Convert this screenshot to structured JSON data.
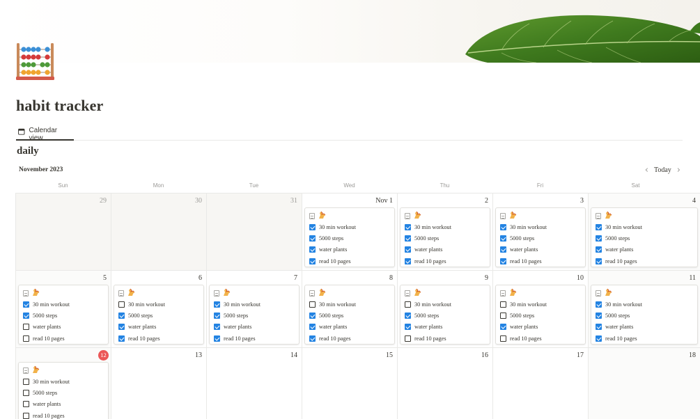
{
  "page": {
    "title": "habit tracker",
    "icon": "abacus-icon",
    "cover": "fig-leaf-cover"
  },
  "views": [
    {
      "label": "Calendar view",
      "icon": "calendar-icon",
      "active": true
    }
  ],
  "section_title": "daily",
  "calendar": {
    "month": "November 2023",
    "today_label": "Today",
    "prev_icon": "chevron-left-icon",
    "next_icon": "chevron-right-icon",
    "weekdays": [
      "Sun",
      "Mon",
      "Tue",
      "Wed",
      "Thu",
      "Fri",
      "Sat"
    ],
    "habit_labels": [
      "30 min workout",
      "5000 steps",
      "water plants",
      "read 10 pages"
    ],
    "card_icons": [
      "page-icon",
      "flexed-arm-emoji-icon"
    ],
    "colors": {
      "checkbox_checked": "#2383e2",
      "today_badge": "#eb5757"
    },
    "weeks": [
      [
        {
          "day": "29",
          "other": true
        },
        {
          "day": "30",
          "other": true
        },
        {
          "day": "31",
          "other": true
        },
        {
          "day": "Nov 1",
          "habits": [
            true,
            true,
            true,
            true
          ]
        },
        {
          "day": "2",
          "habits": [
            true,
            true,
            true,
            true
          ]
        },
        {
          "day": "3",
          "habits": [
            true,
            true,
            true,
            true
          ]
        },
        {
          "day": "4",
          "habits": [
            true,
            true,
            true,
            true
          ]
        }
      ],
      [
        {
          "day": "5",
          "habits": [
            true,
            true,
            false,
            false
          ]
        },
        {
          "day": "6",
          "habits": [
            false,
            true,
            true,
            true
          ]
        },
        {
          "day": "7",
          "habits": [
            true,
            true,
            true,
            true
          ]
        },
        {
          "day": "8",
          "habits": [
            false,
            true,
            true,
            true
          ]
        },
        {
          "day": "9",
          "habits": [
            false,
            true,
            true,
            false
          ]
        },
        {
          "day": "10",
          "habits": [
            false,
            false,
            true,
            false
          ]
        },
        {
          "day": "11",
          "habits": [
            true,
            true,
            true,
            true
          ]
        }
      ],
      [
        {
          "day": "12",
          "today": true,
          "habits": [
            false,
            false,
            false,
            false
          ]
        },
        {
          "day": "13"
        },
        {
          "day": "14"
        },
        {
          "day": "15"
        },
        {
          "day": "16"
        },
        {
          "day": "17"
        },
        {
          "day": "18"
        }
      ]
    ]
  }
}
